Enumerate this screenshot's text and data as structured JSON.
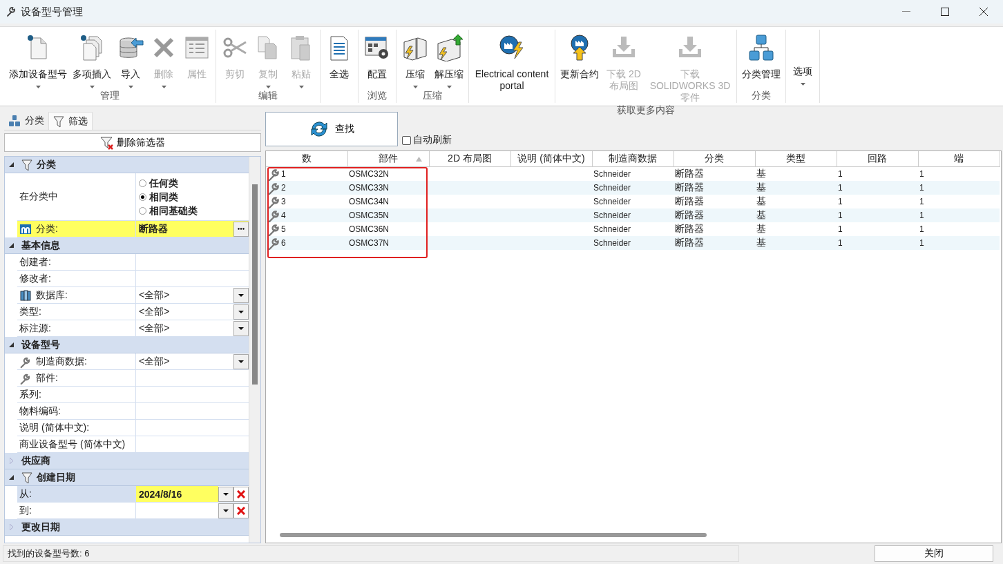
{
  "window": {
    "title": "设备型号管理"
  },
  "ribbon": {
    "groups": [
      {
        "label": "管理",
        "buttons": [
          {
            "kind": "add",
            "label": "添加设备型号",
            "disabled": false,
            "dropdown": true
          },
          {
            "kind": "multi",
            "label": "多项插入",
            "disabled": false,
            "dropdown": true
          },
          {
            "kind": "import",
            "label": "导入",
            "disabled": false,
            "dropdown": true
          },
          {
            "kind": "delete",
            "label": "删除",
            "disabled": true,
            "dropdown": true
          },
          {
            "kind": "props",
            "label": "属性",
            "disabled": true,
            "dropdown": false
          }
        ]
      },
      {
        "label": "编辑",
        "buttons": [
          {
            "kind": "cut",
            "label": "剪切",
            "disabled": true,
            "dropdown": false
          },
          {
            "kind": "copy",
            "label": "复制",
            "disabled": true,
            "dropdown": true
          },
          {
            "kind": "paste",
            "label": "粘贴",
            "disabled": true,
            "dropdown": true
          }
        ]
      },
      {
        "buttons": [
          {
            "kind": "selectall",
            "label": "全选",
            "disabled": false,
            "dropdown": false
          }
        ]
      },
      {
        "label": "浏览",
        "buttons": [
          {
            "kind": "config",
            "label": "配置",
            "disabled": false,
            "dropdown": false
          }
        ]
      },
      {
        "label": "压缩",
        "buttons": [
          {
            "kind": "zip",
            "label": "压缩",
            "disabled": false,
            "dropdown": true
          },
          {
            "kind": "unzip",
            "label": "解压缩",
            "disabled": false,
            "dropdown": true
          }
        ]
      },
      {
        "buttons": [
          {
            "kind": "portal",
            "label": "Electrical content portal",
            "disabled": false,
            "dropdown": false
          }
        ]
      },
      {
        "label": "获取更多内容",
        "buttons": [
          {
            "kind": "update",
            "label": "更新合约",
            "disabled": false,
            "dropdown": false
          },
          {
            "kind": "download",
            "label": "下载 2D 布局图",
            "disabled": true,
            "dropdown": false
          },
          {
            "kind": "download",
            "label": "下载 SOLIDWORKS 3D 零件",
            "disabled": true,
            "dropdown": false
          }
        ]
      },
      {
        "label": "分类",
        "buttons": [
          {
            "kind": "tree",
            "label": "分类管理",
            "disabled": false,
            "dropdown": false
          }
        ]
      },
      {
        "buttons": [
          {
            "kind": "text",
            "label": "选项",
            "disabled": false,
            "dropdown": true
          }
        ]
      }
    ]
  },
  "filter_panel": {
    "tabs": [
      {
        "kind": "tree",
        "label": "分类",
        "selected": false
      },
      {
        "kind": "filter",
        "label": "筛选",
        "selected": true
      }
    ],
    "clear_button": "删除筛选器",
    "sections": [
      {
        "title": "分类",
        "expanded": true,
        "filtered": true,
        "rows": [
          {
            "kind": "radio",
            "label": "在分类中",
            "options": [
              {
                "label": "任何类",
                "selected": false
              },
              {
                "label": "相同类",
                "selected": true
              },
              {
                "label": "相同基础类",
                "selected": false
              }
            ]
          },
          {
            "kind": "picker",
            "label": "分类:",
            "value": "断路器",
            "highlighted": true
          }
        ]
      },
      {
        "title": "基本信息",
        "expanded": true,
        "filtered": false,
        "rows": [
          {
            "kind": "text",
            "label": "创建者:"
          },
          {
            "kind": "text",
            "label": "修改者:"
          },
          {
            "kind": "combo",
            "label": "数据库:",
            "value": "<全部>"
          },
          {
            "kind": "combo",
            "label": "类型:",
            "value": "<全部>"
          },
          {
            "kind": "combo",
            "label": "标注源:",
            "value": "<全部>"
          }
        ]
      },
      {
        "title": "设备型号",
        "expanded": true,
        "filtered": false,
        "rows": [
          {
            "kind": "combo",
            "label": "制造商数据:",
            "value": "<全部>"
          },
          {
            "kind": "text",
            "label": "部件:"
          },
          {
            "kind": "text",
            "label": "系列:"
          },
          {
            "kind": "text",
            "label": "物料编码:"
          },
          {
            "kind": "text",
            "label": "说明 (简体中文):"
          },
          {
            "kind": "text",
            "label": "商业设备型号 (简体中文)"
          }
        ]
      },
      {
        "title": "供应商",
        "expanded": false,
        "filtered": false
      },
      {
        "title": "创建日期",
        "expanded": true,
        "filtered": true,
        "rows": [
          {
            "kind": "date",
            "label": "从:",
            "value": "2024/8/16",
            "highlighted": true,
            "selected": true
          },
          {
            "kind": "date",
            "label": "到:",
            "highlighted": false,
            "selected": false
          }
        ]
      },
      {
        "title": "更改日期",
        "expanded": false,
        "filtered": false
      }
    ]
  },
  "results": {
    "search_button": "查找",
    "auto_refresh": {
      "label": "自动刷新",
      "checked": false
    },
    "outline": true,
    "table": {
      "columns": [
        {
          "label": "数",
          "sorted": false
        },
        {
          "label": "部件",
          "sorted": true
        },
        {
          "label": "2D 布局图",
          "sorted": false
        },
        {
          "label": "说明 (简体中文)",
          "sorted": false
        },
        {
          "label": "制造商数据",
          "sorted": false
        },
        {
          "label": "分类",
          "sorted": false
        },
        {
          "label": "类型",
          "sorted": false
        },
        {
          "label": "回路",
          "sorted": false
        },
        {
          "label": "端",
          "sorted": false
        }
      ],
      "rows": [
        {
          "cells": [
            "1",
            "OSMC32N",
            "",
            "",
            "Schneider",
            "断路器",
            "基",
            "1",
            "1"
          ]
        },
        {
          "cells": [
            "2",
            "OSMC33N",
            "",
            "",
            "Schneider",
            "断路器",
            "基",
            "1",
            "1"
          ]
        },
        {
          "cells": [
            "3",
            "OSMC34N",
            "",
            "",
            "Schneider",
            "断路器",
            "基",
            "1",
            "1"
          ]
        },
        {
          "cells": [
            "4",
            "OSMC35N",
            "",
            "",
            "Schneider",
            "断路器",
            "基",
            "1",
            "1"
          ]
        },
        {
          "cells": [
            "5",
            "OSMC36N",
            "",
            "",
            "Schneider",
            "断路器",
            "基",
            "1",
            "1"
          ]
        },
        {
          "cells": [
            "6",
            "OSMC37N",
            "",
            "",
            "Schneider",
            "断路器",
            "基",
            "1",
            "1"
          ]
        }
      ]
    }
  },
  "status_bar": {
    "text": "找到的设备型号数: 6",
    "close_button": "关闭"
  }
}
